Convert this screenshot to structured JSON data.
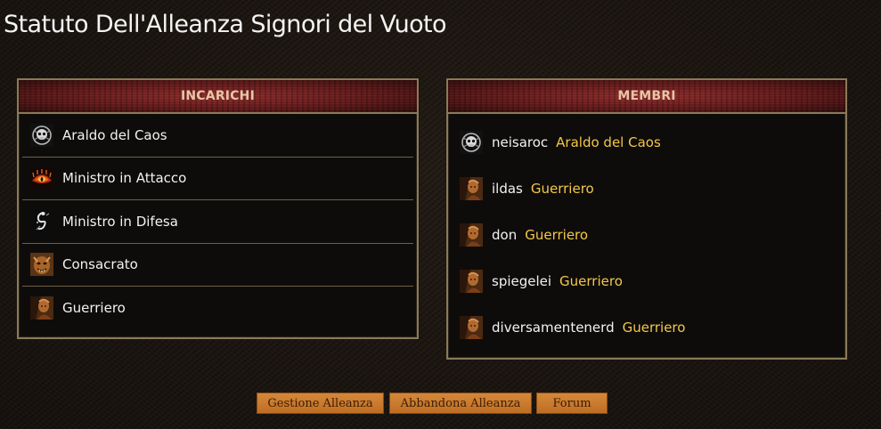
{
  "page": {
    "title": "Statuto Dell'Alleanza Signori del Vuoto"
  },
  "roles_panel": {
    "header": "INCARICHI",
    "items": [
      {
        "label": "Araldo del Caos",
        "icon": "skull-emblem-icon"
      },
      {
        "label": "Ministro in Attacco",
        "icon": "flaming-eye-icon"
      },
      {
        "label": "Ministro in Difesa",
        "icon": "serpent-shield-icon"
      },
      {
        "label": "Consacrato",
        "icon": "demon-face-icon"
      },
      {
        "label": "Guerriero",
        "icon": "warrior-portrait-icon"
      }
    ]
  },
  "members_panel": {
    "header": "MEMBRI",
    "members": [
      {
        "name": "neisaroc",
        "role": "Araldo del Caos",
        "icon": "skull-emblem-icon"
      },
      {
        "name": "ildas",
        "role": "Guerriero",
        "icon": "warrior-portrait-icon"
      },
      {
        "name": "don",
        "role": "Guerriero",
        "icon": "warrior-portrait-icon"
      },
      {
        "name": "spiegelei",
        "role": "Guerriero",
        "icon": "warrior-portrait-icon"
      },
      {
        "name": "diversamentenerd",
        "role": "Guerriero",
        "icon": "warrior-portrait-icon"
      }
    ]
  },
  "actions": {
    "manage_label": "Gestione Alleanza",
    "leave_label": "Abbandona Alleanza",
    "forum_label": "Forum"
  },
  "colors": {
    "accent_gold": "#f2c84a",
    "header_text": "#e8c5a6",
    "button_orange": "#cc7a2e",
    "panel_border": "#8a7a58"
  }
}
